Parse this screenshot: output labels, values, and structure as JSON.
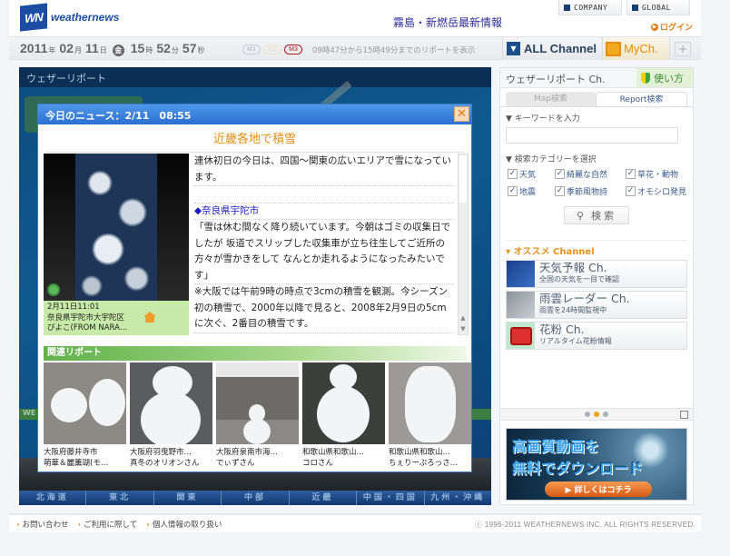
{
  "header": {
    "logo_mark": "WN",
    "logo_text": "weathernews",
    "headline_link": "霧島・新燃岳最新情報",
    "company_label": "COMPANY",
    "global_label": "GLOBAL",
    "login_label": "ログイン"
  },
  "datebar": {
    "year": "2011",
    "year_unit": "年",
    "month": "02",
    "month_unit": "月",
    "day": "11",
    "day_unit": "日",
    "weekday": "金",
    "hour": "15",
    "hour_unit": "時",
    "minute": "52",
    "minute_unit": "分",
    "second": "57",
    "second_unit": "秒",
    "modes": [
      "M1",
      "M2",
      "M3"
    ],
    "active_mode": "M3",
    "range_text": "09時47分から15時49分までのリポートを表示",
    "all_channel_label": "ALL Channel",
    "mych_label": "MyCh.",
    "add_label": "+"
  },
  "main": {
    "title": "ウェザーリポート",
    "weather_strip": "WE",
    "regions": [
      "北海道",
      "東北",
      "関東",
      "中部",
      "近畿",
      "中国・四国",
      "九州・沖縄"
    ]
  },
  "popup": {
    "header": "今日のニュース：2/11　08:55",
    "close_label": "✕",
    "title": "近畿各地で積雪",
    "photo_caption": {
      "datetime": "2月11日11:01",
      "location": "奈良県宇陀市大宇陀区",
      "author": "ぴよこ(FROM NARA…"
    },
    "paragraphs": [
      "連休初日の今日は、四国〜関東の広いエリアで雪になっています。",
      "",
      "◆奈良県宇陀市",
      "「雪は休む間なく降り続いています。今朝はゴミの収集日でしたが 坂道でスリップした収集車が立ち往生してご近所の方々が雪かきをして なんとか走れるようになったみたいです」",
      "※大阪では午前9時の時点で3cmの積雪を観測。今シーズン初の積雪で、2000年以降で見ると、2008年2月9日の5cmに次ぐ、2番目の積雪です。"
    ],
    "related_title": "関連リポート",
    "related": [
      {
        "line1": "大阪府藤井寺市",
        "line2": "萌華＆麗薫瑚(モ…"
      },
      {
        "line1": "大阪府羽曳野市…",
        "line2": "真冬のオリオンさん"
      },
      {
        "line1": "大阪府泉南市海…",
        "line2": "でぃずさん"
      },
      {
        "line1": "和歌山県和歌山…",
        "line2": "コロさん"
      },
      {
        "line1": "和歌山県和歌山…",
        "line2": "ちぇりーぷろっさ…"
      }
    ]
  },
  "side": {
    "title": "ウェザーリポート Ch.",
    "howto_label": "使い方",
    "tabs": [
      {
        "label": "Map検索",
        "active": false
      },
      {
        "label": "Report検索",
        "active": true
      }
    ],
    "keyword_label": "▼ キーワードを入力",
    "keyword_value": "",
    "category_label": "▼ 検索カテゴリーを選択",
    "categories": [
      {
        "label": "天気",
        "checked": true
      },
      {
        "label": "綺麗な自然",
        "checked": true
      },
      {
        "label": "草花・動物",
        "checked": true
      },
      {
        "label": "地震",
        "checked": true
      },
      {
        "label": "季節風物詩",
        "checked": true
      },
      {
        "label": "オモシロ発見",
        "checked": true
      }
    ],
    "search_label": "検索",
    "recommend_title": "▾ オススメ Channel",
    "channels": [
      {
        "title": "天気予報 Ch.",
        "sub": "全国の天気を一目で確認"
      },
      {
        "title": "雨雲レーダー Ch.",
        "sub": "雨雲を24時間監視中"
      },
      {
        "title": "花粉 Ch.",
        "sub": "リアルタイム花粉情報"
      }
    ],
    "pager": {
      "pages": 3,
      "current": 2
    },
    "banner": {
      "line1": "高画質動画を",
      "line2": "無料でダウンロード",
      "button": "▶ 詳しくはコチラ"
    }
  },
  "footer": {
    "links": [
      "お問い合わせ",
      "ご利用に際して",
      "個人情報の取り扱い"
    ],
    "copyright": "ⓒ 1996-2011 WEATHERNEWS INC. ALL RIGHTS RESERVED."
  },
  "colors": {
    "brand_blue": "#1b4ea3",
    "accent_orange": "#e08e16",
    "popup_header": "#2b6fd0",
    "related_green": "#61b24a",
    "active_mode_red": "#b01818"
  }
}
